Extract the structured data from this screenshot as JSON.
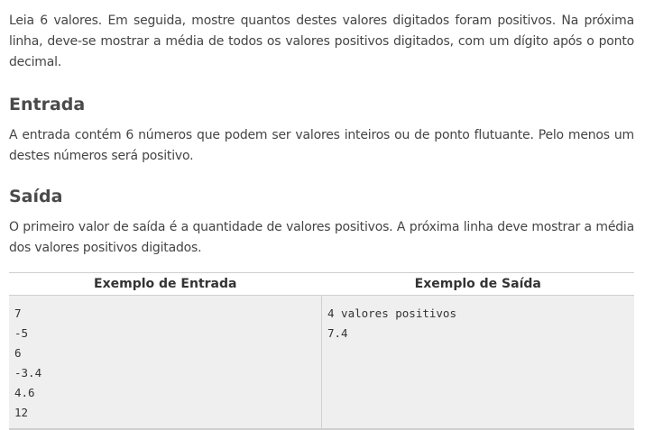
{
  "intro": "Leia 6 valores. Em seguida, mostre quantos destes valores digitados foram positivos. Na próxima linha, deve-se mostrar a média de todos os valores positivos digitados, com um dígito após o ponto decimal.",
  "entrada": {
    "heading": "Entrada",
    "text": "A entrada contém 6 números que podem ser valores inteiros ou de ponto flutuante. Pelo menos um destes números será positivo."
  },
  "saida": {
    "heading": "Saída",
    "text": "O primeiro valor de saída é a quantidade de valores positivos. A próxima linha deve mostrar a média dos valores positivos digitados."
  },
  "examples": {
    "input_header": "Exemplo de Entrada",
    "output_header": "Exemplo de Saída",
    "input_lines": [
      "7",
      "-5",
      "6",
      "-3.4",
      "4.6",
      "12"
    ],
    "output_lines": [
      "4 valores positivos",
      "7.4"
    ]
  }
}
